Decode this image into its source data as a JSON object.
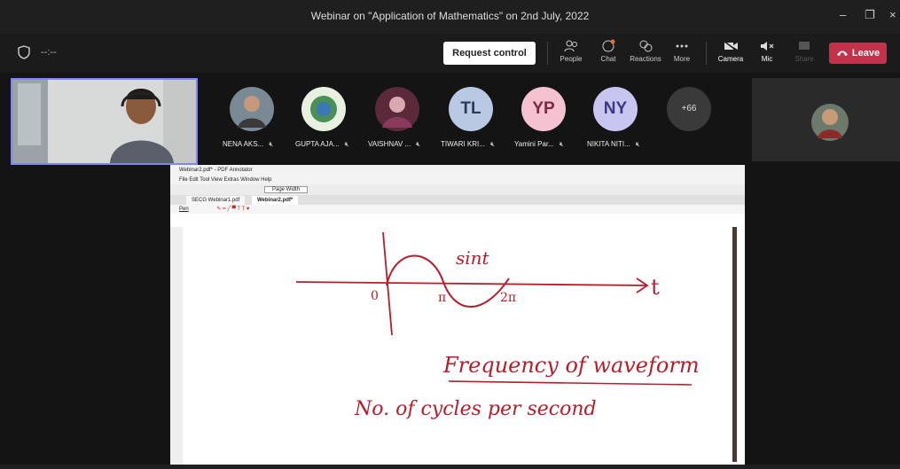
{
  "window": {
    "title": "Webinar on \"Application of Mathematics\" on 2nd July, 2022",
    "minimize": "–",
    "restore": "❐",
    "close": "×"
  },
  "toolbar": {
    "timer": "--:--",
    "request_control": "Request control",
    "buttons": [
      {
        "label": "People",
        "icon": "people-icon"
      },
      {
        "label": "Chat",
        "icon": "chat-icon"
      },
      {
        "label": "Reactions",
        "icon": "reactions-icon"
      },
      {
        "label": "More",
        "icon": "more-icon"
      },
      {
        "label": "Camera",
        "icon": "camera-off-icon"
      },
      {
        "label": "Mic",
        "icon": "mic-muted-icon"
      },
      {
        "label": "Share",
        "icon": "share-icon"
      }
    ],
    "leave": "Leave",
    "colors": {
      "leave": "#c4314b",
      "accent": "#7f85f5"
    }
  },
  "participants": [
    {
      "name": "NENA AKS...",
      "type": "photo"
    },
    {
      "name": "GUPTA AJA...",
      "type": "photo"
    },
    {
      "name": "VAISHNAV ...",
      "type": "photo"
    },
    {
      "name": "TIWARI KRI...",
      "initials": "TL",
      "color": "#b9c8e3"
    },
    {
      "name": "Yamini Par...",
      "initials": "YP",
      "color": "#f4c2d0"
    },
    {
      "name": "NIKITA NITI...",
      "initials": "NY",
      "color": "#c8c6f0"
    }
  ],
  "overflow_count": "+66",
  "pdf": {
    "title": "Webinar2.pdf* - PDF Annotator",
    "menu": "File  Edit  Tool  View  Extras  Window  Help",
    "zoom": "Page Width",
    "tabs": [
      "SECG Webinar1.pdf",
      "Webinar2.pdf*"
    ],
    "pen_label": "Pen",
    "handwriting": {
      "fn": "sint",
      "axis": "t",
      "origin": "0",
      "pi": "π",
      "two_pi": "2π",
      "heading": "Frequency of waveform",
      "line": "No. of cycles per second"
    }
  }
}
